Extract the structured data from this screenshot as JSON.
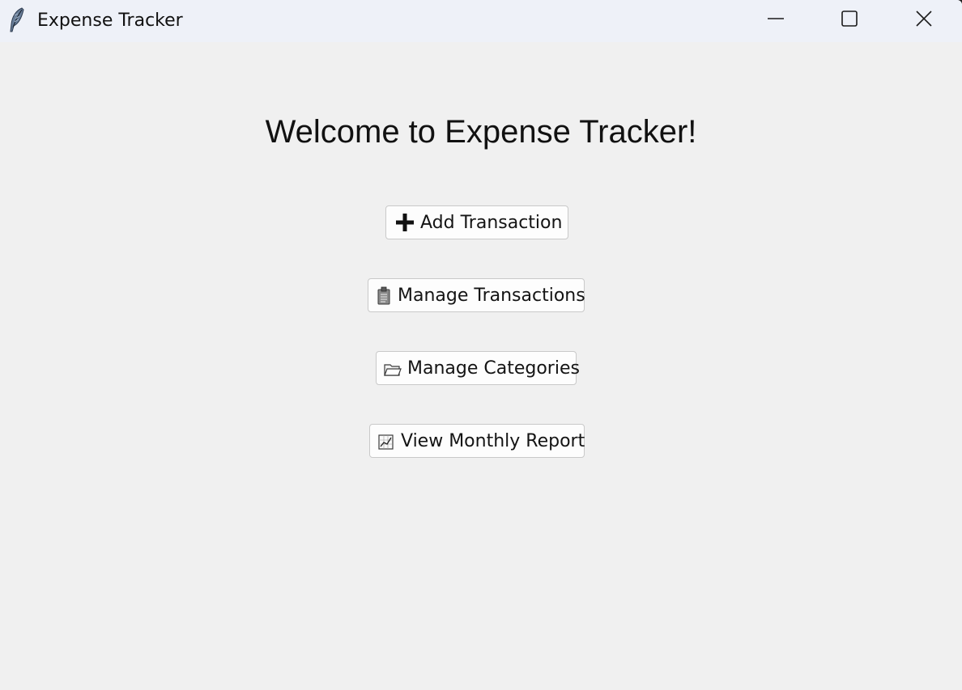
{
  "window": {
    "title": "Expense Tracker",
    "app_icon": "feather-icon",
    "controls": {
      "minimize": "minimize-icon",
      "maximize": "maximize-icon",
      "close": "close-icon"
    }
  },
  "main": {
    "heading": "Welcome to Expense Tracker!",
    "buttons": [
      {
        "label": "Add Transaction",
        "icon": "plus-icon"
      },
      {
        "label": "Manage Transactions",
        "icon": "clipboard-icon"
      },
      {
        "label": "Manage Categories",
        "icon": "folder-icon"
      },
      {
        "label": "View Monthly Report",
        "icon": "chart-icon"
      }
    ]
  }
}
